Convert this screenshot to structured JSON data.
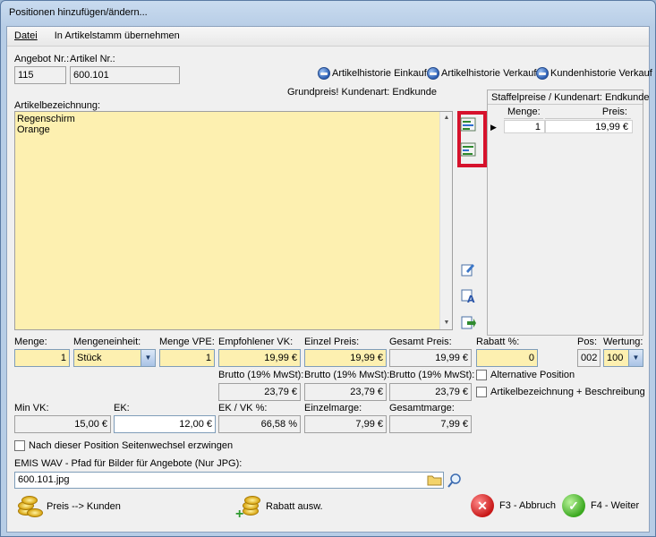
{
  "window": {
    "title": "Positionen hinzufügen/ändern..."
  },
  "menu": {
    "datei": "Datei",
    "uebernehmen": "In Artikelstamm übernehmen"
  },
  "header": {
    "angebot_label": "Angebot Nr.:",
    "angebot_value": "115",
    "artikel_label": "Artikel Nr.:",
    "artikel_value": "600.101",
    "hist_einkauf": "Artikelhistorie Einkauf",
    "hist_verkauf": "Artikelhistorie Verkauf",
    "hist_kunden": "Kundenhistorie Verkauf",
    "grundpreis": "Grundpreis! Kundenart: Endkunde"
  },
  "artikelbezeichnung": {
    "label": "Artikelbezeichnung:",
    "line1": "Regenschirm",
    "line2": "Orange"
  },
  "staffel": {
    "title": "Staffelpreise / Kundenart: Endkunde",
    "col_menge": "Menge:",
    "col_preis": "Preis:",
    "rows": [
      {
        "menge": "1",
        "preis": "19,99 €"
      }
    ]
  },
  "fields": {
    "menge_label": "Menge:",
    "menge_value": "1",
    "einheit_label": "Mengeneinheit:",
    "einheit_value": "Stück",
    "vpe_label": "Menge VPE:",
    "vpe_value": "1",
    "empf_label": "Empfohlener VK:",
    "empf_value": "19,99 €",
    "einzel_label": "Einzel Preis:",
    "einzel_value": "19,99 €",
    "gesamt_label": "Gesamt Preis:",
    "gesamt_value": "19,99 €",
    "rabatt_label": "Rabatt %:",
    "rabatt_value": "0",
    "pos_label": "Pos:",
    "pos_value": "002",
    "wertung_label": "Wertung:",
    "wertung_value": "100",
    "brutto1_label": "Brutto (19% MwSt):",
    "brutto1_value": "23,79 €",
    "brutto2_label": "Brutto (19% MwSt):",
    "brutto2_value": "23,79 €",
    "brutto3_label": "Brutto (19% MwSt):",
    "brutto3_value": "23,79 €",
    "alternative": "Alternative Position",
    "artbez_beschr": "Artikelbezeichnung + Beschreibung",
    "minvk_label": "Min VK:",
    "minvk_value": "15,00 €",
    "ek_label": "EK:",
    "ek_value": "12,00 €",
    "ekvk_label": "EK / VK %:",
    "ekvk_value": "66,58 %",
    "einzelmarge_label": "Einzelmarge:",
    "einzelmarge_value": "7,99 €",
    "gesamtmarge_label": "Gesamtmarge:",
    "gesamtmarge_value": "7,99 €",
    "seitenwechsel": "Nach dieser Position Seitenwechsel erzwingen",
    "pfad_label": "EMIS WAV - Pfad für Bilder für Angebote (Nur JPG):",
    "pfad_value": "600.101.jpg"
  },
  "buttons": {
    "preis_kunden": "Preis --> Kunden",
    "rabatt": "Rabatt ausw.",
    "abbruch": "F3 - Abbruch",
    "weiter": "F4 - Weiter"
  }
}
